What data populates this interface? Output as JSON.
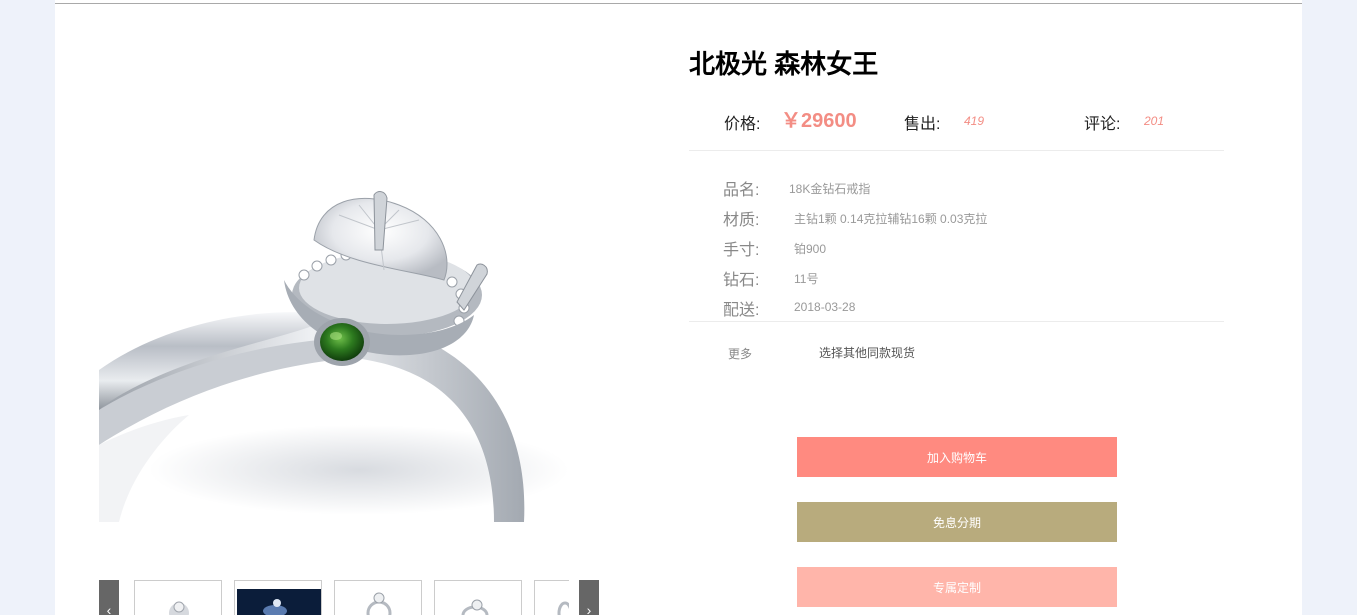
{
  "product": {
    "title": "北极光 森林女王"
  },
  "summary": {
    "price_label": "价格:",
    "price": "￥29600",
    "sold_label": "售出:",
    "sold_count": "419",
    "review_label": "评论:",
    "review_count": "201"
  },
  "specs": [
    {
      "label": "品名:",
      "value": "18K金钻石戒指"
    },
    {
      "label": "材质:",
      "value": "主钻1颗 0.14克拉辅钻16颗 0.03克拉"
    },
    {
      "label": "手寸:",
      "value": "铂900"
    },
    {
      "label": "钻石:",
      "value": "11号"
    },
    {
      "label": "配送:",
      "value": "2018-03-28"
    }
  ],
  "more": {
    "label": "更多",
    "link": "选择其他同款现货"
  },
  "buttons": {
    "add_to_cart": "加入购物车",
    "installment": "免息分期",
    "custom": "专属定制"
  },
  "colors": {
    "accent_pink": "#f38d84",
    "cart_button": "#ff8a80",
    "installment_button": "#b8ab7d",
    "custom_button": "#ffb5aa",
    "page_background": "#eef2fa"
  },
  "icons": {
    "carousel_prev": "chevron-left-icon",
    "carousel_next": "chevron-right-icon"
  }
}
